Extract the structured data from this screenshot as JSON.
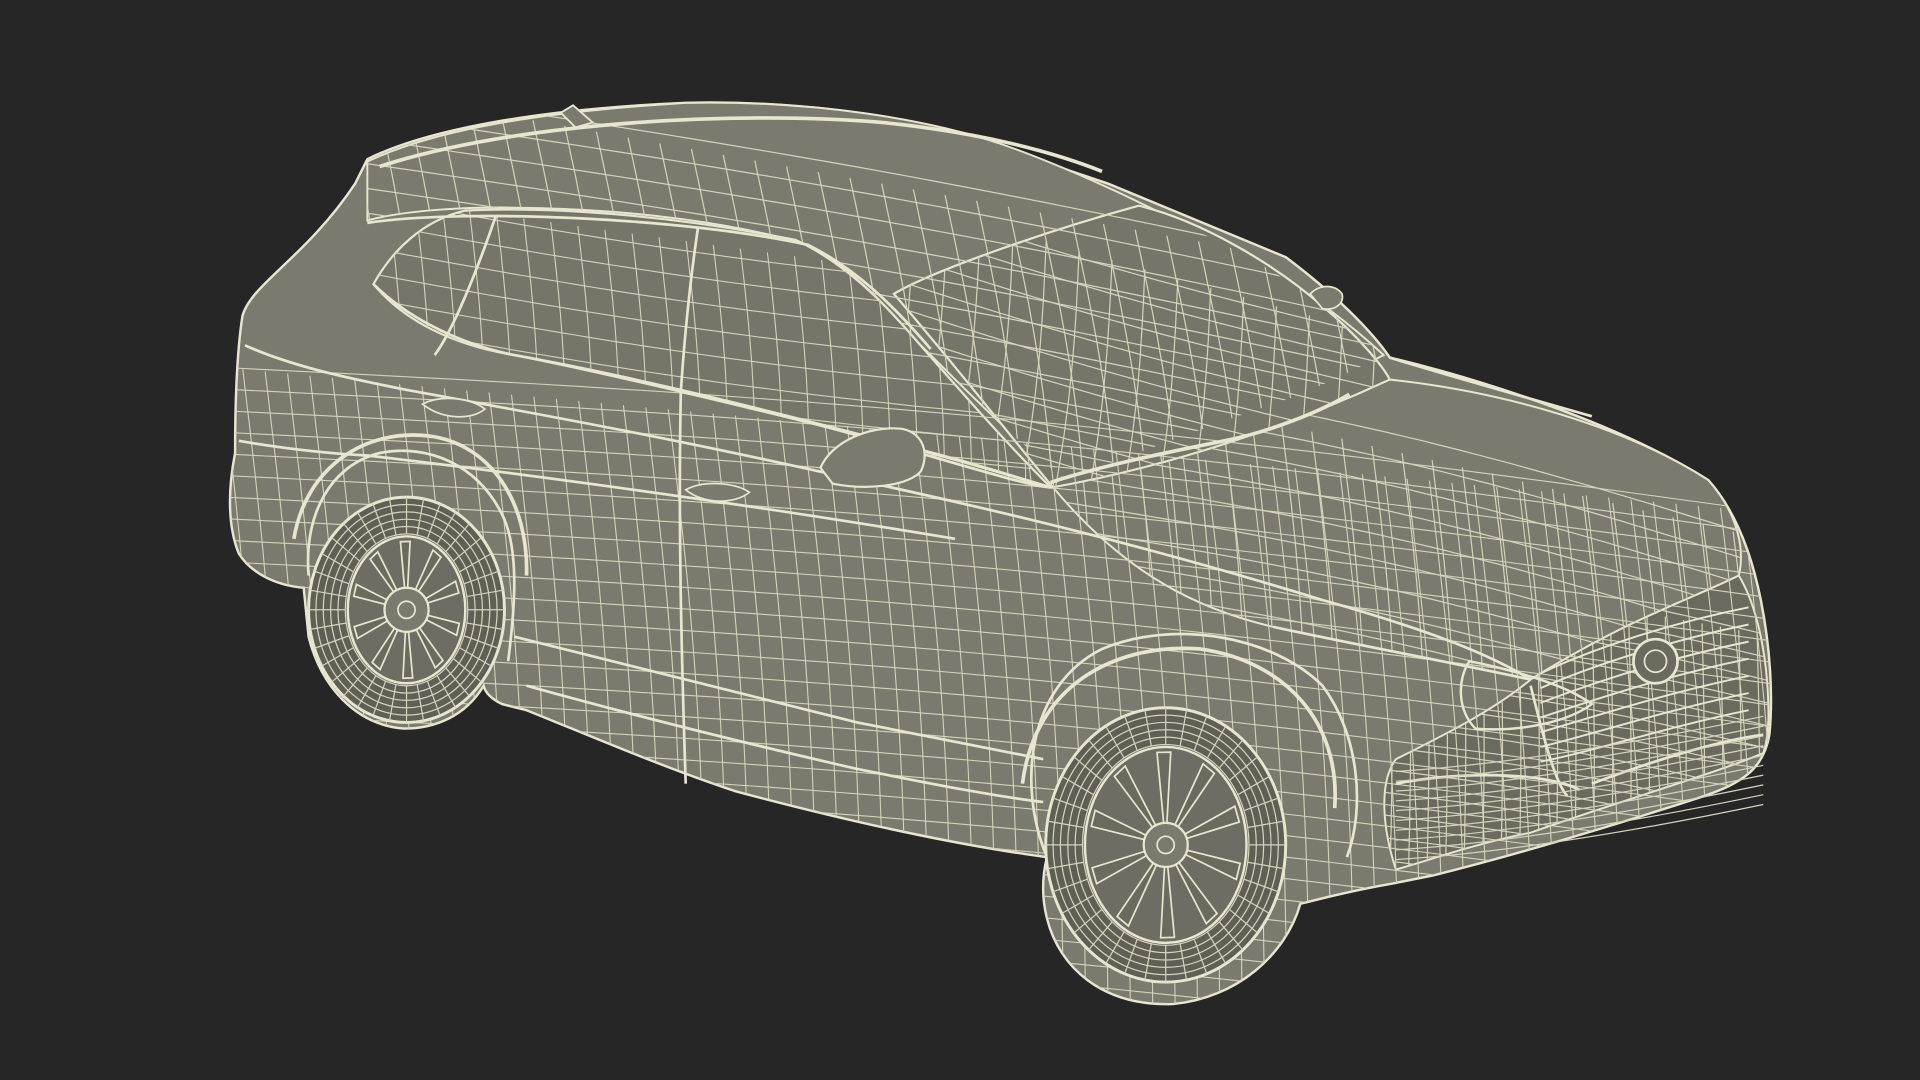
{
  "scene": {
    "subject": "car-wireframe",
    "colors": {
      "background": "#262626",
      "body_fill": "#7a7a6e",
      "body_fill_dark": "#6a6a5f",
      "glass_fill": "#75756a",
      "tire_fill": "#5f5f56",
      "rim_fill": "#6d6d63",
      "wire": "#e9e6cf",
      "wire_soft": "#d6d3bb"
    }
  }
}
